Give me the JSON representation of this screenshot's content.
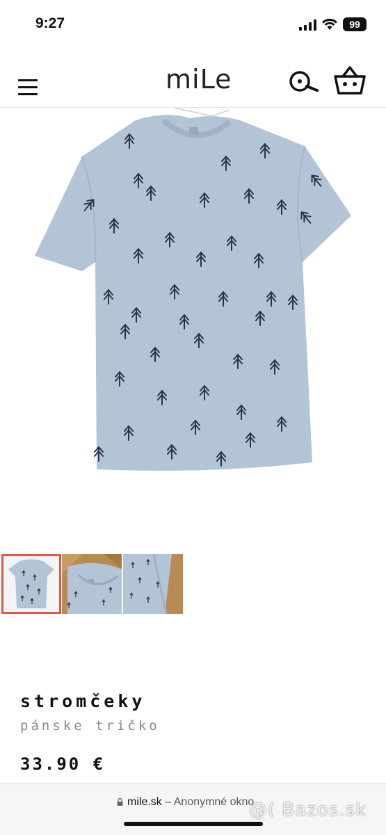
{
  "status_bar": {
    "time": "9:27",
    "battery": "99"
  },
  "header": {
    "logo": "miLe"
  },
  "icons": {
    "menu": "hamburger-menu-icon",
    "search": "search-icon",
    "cart": "shopping-basket-icon"
  },
  "colors": {
    "shirt": "#b3c4d6",
    "tree": "#2b3444",
    "thumb_active_border": "#d9594c",
    "wood": "#b98a55"
  },
  "product": {
    "title": "stromčeky",
    "subtitle": "pánske tričko",
    "price": "33.90 €"
  },
  "gallery": {
    "thumbnail_count": 3,
    "active_index": 0
  },
  "browser": {
    "host": "mile.sk",
    "mode": "– Anonymné okno"
  },
  "watermark": "@( Bazos.sk"
}
